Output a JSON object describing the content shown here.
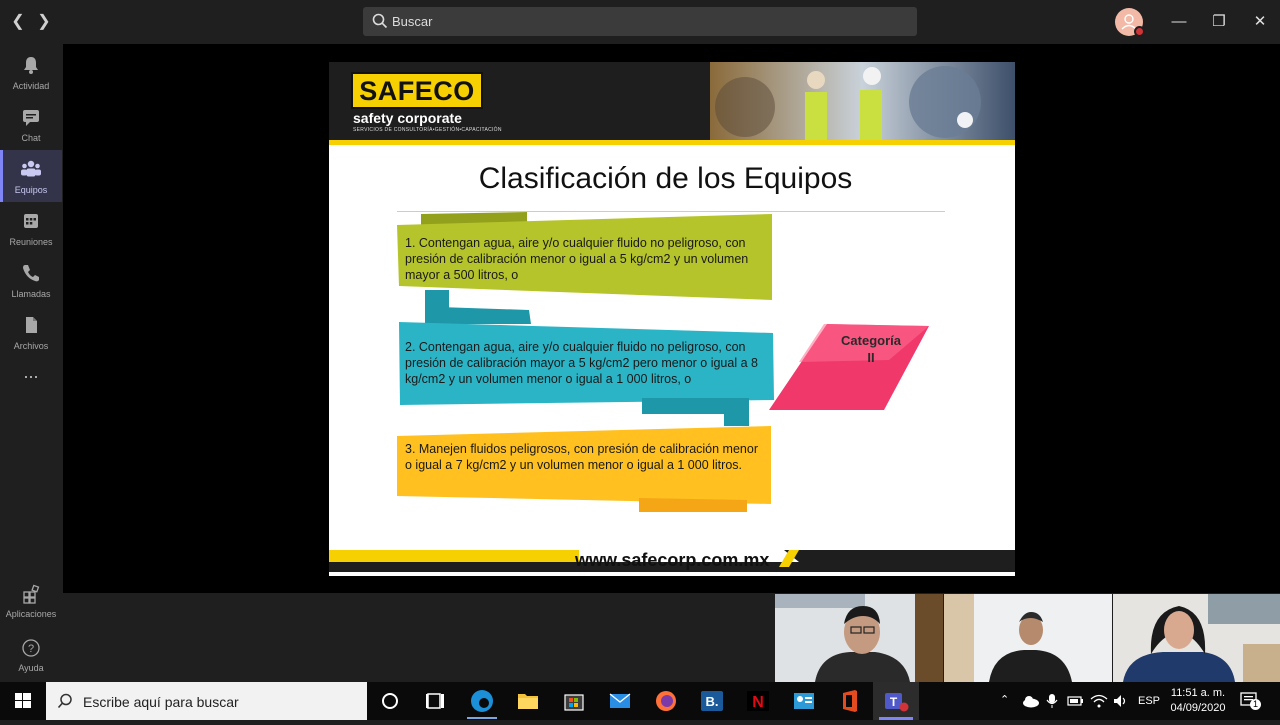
{
  "search": {
    "placeholder": "Buscar"
  },
  "rail": {
    "items": [
      {
        "label": "Actividad",
        "icon": "bell-icon"
      },
      {
        "label": "Chat",
        "icon": "chat-icon"
      },
      {
        "label": "Equipos",
        "icon": "teams-icon",
        "active": true
      },
      {
        "label": "Reuniones",
        "icon": "calendar-icon"
      },
      {
        "label": "Llamadas",
        "icon": "phone-icon"
      },
      {
        "label": "Archivos",
        "icon": "file-icon"
      }
    ],
    "more": "...",
    "apps": "Aplicaciones",
    "help": "Ayuda"
  },
  "slide": {
    "logo": "SAFECO",
    "logo_sub": "safety corporate",
    "logo_sub2": "SERVICIOS DE CONSULTORÍA•GESTIÓN•CAPACITACIÓN",
    "title": "Clasificación de los Equipos",
    "items": [
      "1. Contengan agua, aire y/o cualquier fluido no peligroso, con presión de calibración menor o igual a 5 kg/cm2 y un volumen mayor a 500 litros, o",
      "2. Contengan agua, aire y/o cualquier fluido no peligroso, con presión de calibración mayor a 5 kg/cm2 pero menor o igual a 8 kg/cm2 y un volumen menor o igual a 1 000 litros, o",
      "3. Manejen fluidos peligrosos, con presión de calibración menor o igual a 7 kg/cm2 y un volumen menor o igual a 1 000 litros."
    ],
    "category_line1": "Categoría",
    "category_line2": "II",
    "footer_url": "www.safecorp.com.mx",
    "colors": {
      "green": "#b5c42b",
      "teal": "#2bb4c6",
      "orange": "#ffc020",
      "pink": "#f0386b",
      "yellow": "#f6d000"
    }
  },
  "taskbar": {
    "search_placeholder": "Escribe aquí para buscar",
    "lang": "ESP",
    "time": "11:51 a. m.",
    "date": "04/09/2020",
    "notif_count": "1"
  }
}
